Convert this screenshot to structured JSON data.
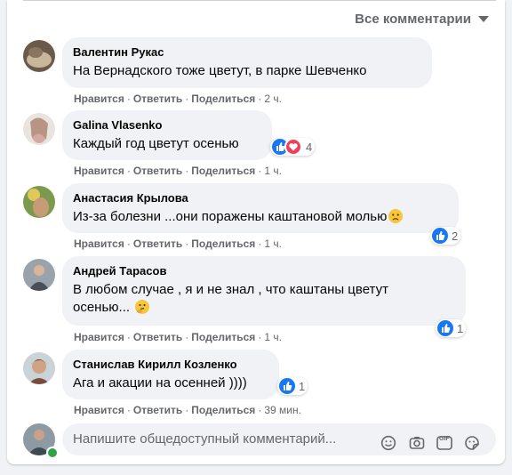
{
  "header": {
    "sort_label": "Все комментарии"
  },
  "actions": {
    "like": "Нравится",
    "reply": "Ответить",
    "share": "Поделиться",
    "sep": "·"
  },
  "comments": [
    {
      "author": "Валентин Рукас",
      "text": "На Вернадского тоже цветут, в парке Шевченко",
      "time": "2 ч.",
      "reactions": null
    },
    {
      "author": "Galina Vlasenko",
      "text": "Каждый год цветут осенью",
      "time": "1 ч.",
      "reactions": {
        "icons": [
          "like",
          "love"
        ],
        "count": "4"
      }
    },
    {
      "author": "Анастасия Крылова",
      "text": "Из-за болезни ...они поражены каштановой молью",
      "time": "1 ч.",
      "reactions": {
        "icons": [
          "like"
        ],
        "count": "2"
      },
      "emoji": "disappointed"
    },
    {
      "author": "Андрей Тарасов",
      "text": "В любом случае , я и не знал , что каштаны цветут",
      "text2": "осенью...",
      "time": "1 ч.",
      "reactions": {
        "icons": [
          "like"
        ],
        "count": "1"
      },
      "emoji": "thinking"
    },
    {
      "author": "Станислав Кирилл Козленко",
      "text": "Ага и акации на осенней ))))",
      "time": "39 мин.",
      "reactions": {
        "icons": [
          "like"
        ],
        "count": "1"
      }
    }
  ],
  "composer": {
    "placeholder": "Напишите общедоступный комментарий...",
    "tools": [
      "emoji-icon",
      "camera-icon",
      "gif-icon",
      "sticker-icon"
    ],
    "gif_label": "GIF"
  },
  "colors": {
    "accent": "#1877f2",
    "love": "#f33e58",
    "bubble": "#f0f2f5",
    "meta": "#65676b",
    "online": "#31a24c"
  }
}
